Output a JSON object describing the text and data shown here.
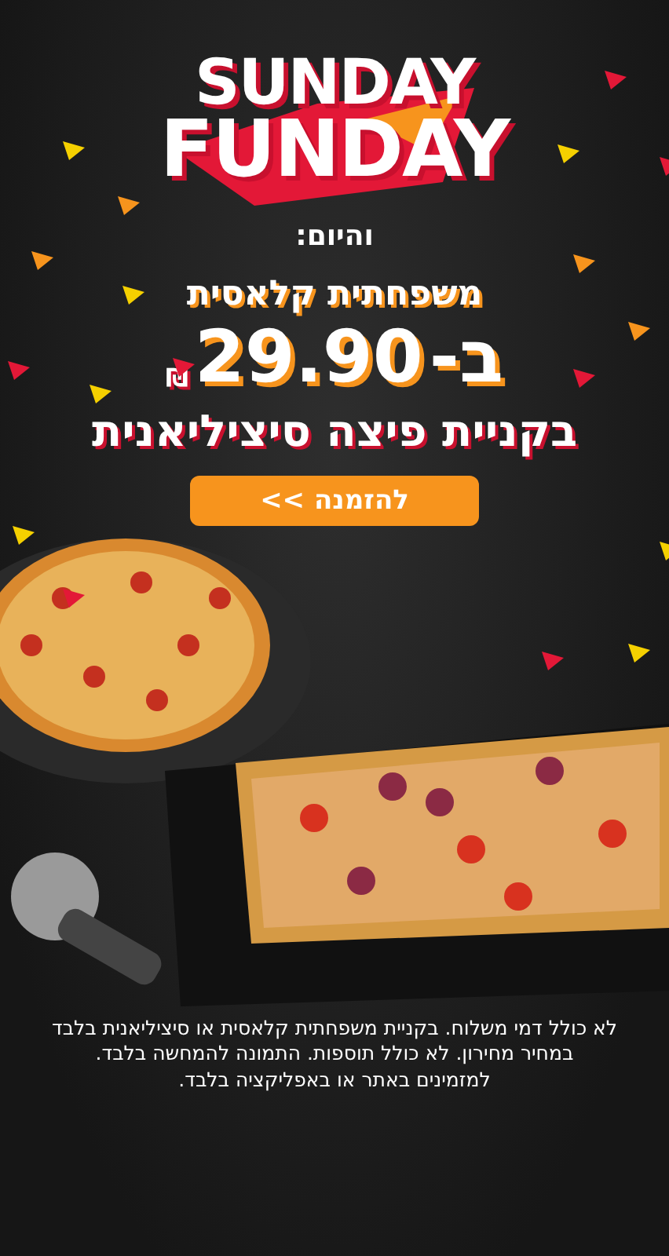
{
  "logo": {
    "line_1": "SUNDAY",
    "line_2": "FUNDAY"
  },
  "intro": "והיום:",
  "offer": {
    "product": "משפחתית קלאסית",
    "price_prefix": "ב-",
    "price": "29.90",
    "currency": "₪",
    "condition": "בקניית פיצה סיציליאנית"
  },
  "order_button": {
    "label": "להזמנה >>"
  },
  "disclaimer": [
    "לא כולל דמי משלוח. בקניית משפחתית קלאסית או סיציליאנית בלבד",
    "במחיר מחירון. לא כולל תוספות. התמונה להמחשה בלבד.",
    "למזמינים באתר או באפליקציה בלבד."
  ]
}
